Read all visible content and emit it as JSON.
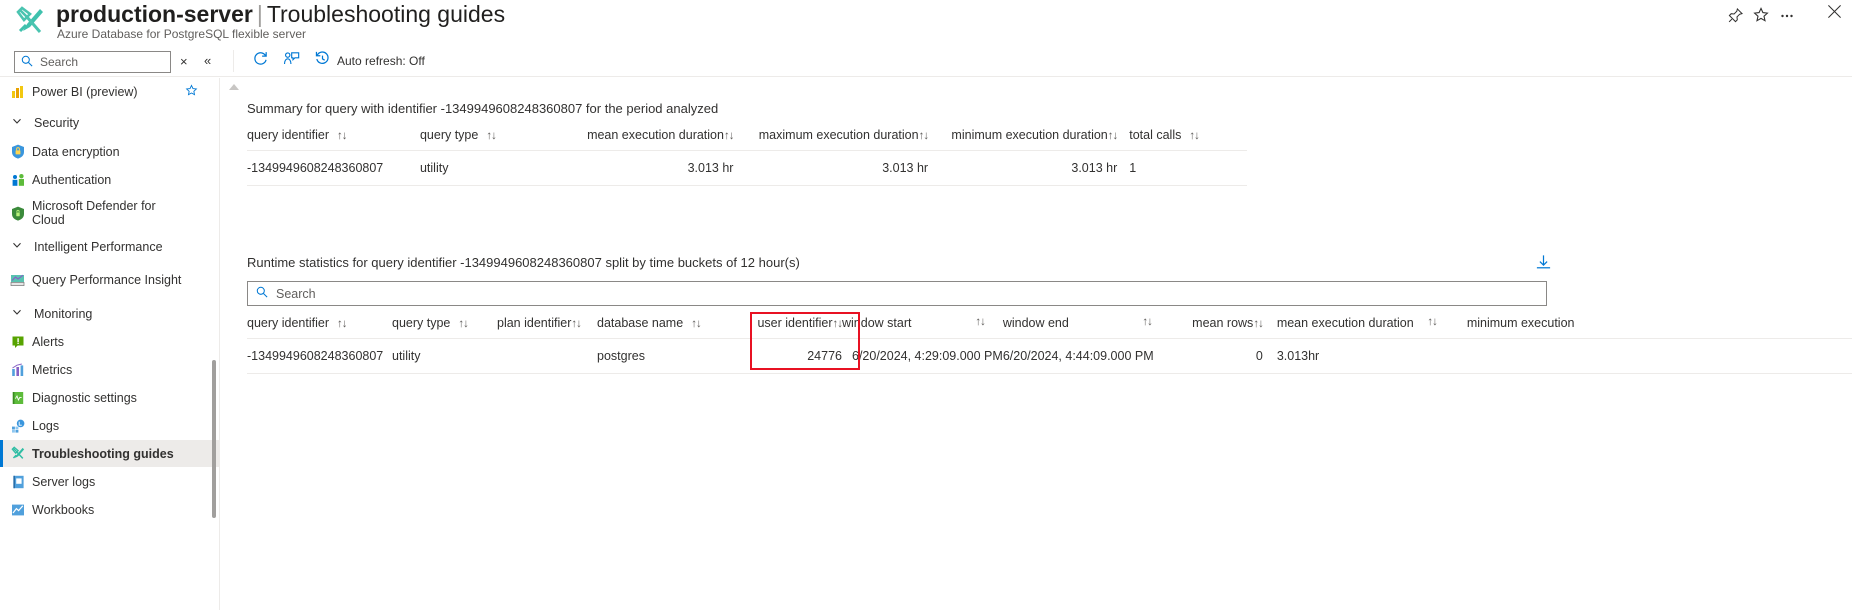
{
  "header": {
    "resource_name": "production-server",
    "separator": "|",
    "blade_name": "Troubleshooting guides",
    "subtitle": "Azure Database for PostgreSQL flexible server",
    "pin_icon": "pin-icon",
    "favorite_icon": "star-icon",
    "more_icon": "ellipsis-icon",
    "close_icon": "close-icon"
  },
  "toolbar": {
    "search_placeholder": "Search",
    "clear_label": "×",
    "collapse_label": "«",
    "refresh_label": "",
    "refresh_icon": "refresh-icon",
    "feedback_icon": "feedback-icon",
    "auto_refresh_icon": "clock-history-icon",
    "auto_refresh_label": "Auto refresh: Off"
  },
  "sidebar": {
    "items": [
      {
        "label": "Power BI (preview)",
        "type": "item",
        "icon": "powerbi-icon",
        "starred": true,
        "selected": false
      },
      {
        "label": "Security",
        "type": "group",
        "icon": "chevron-down-icon",
        "selected": false
      },
      {
        "label": "Data encryption",
        "type": "item",
        "icon": "key-shield-icon",
        "selected": false
      },
      {
        "label": "Authentication",
        "type": "item",
        "icon": "users-icon",
        "selected": false
      },
      {
        "label": "Microsoft Defender for Cloud",
        "type": "item",
        "icon": "defender-shield-icon",
        "selected": false
      },
      {
        "label": "Intelligent Performance",
        "type": "group",
        "icon": "chevron-down-icon",
        "selected": false
      },
      {
        "label": "Query Performance Insight",
        "type": "item",
        "icon": "query-insight-icon",
        "selected": false
      },
      {
        "label": "Monitoring",
        "type": "group",
        "icon": "chevron-down-icon",
        "selected": false
      },
      {
        "label": "Alerts",
        "type": "item",
        "icon": "alert-icon",
        "selected": false
      },
      {
        "label": "Metrics",
        "type": "item",
        "icon": "metrics-icon",
        "selected": false
      },
      {
        "label": "Diagnostic settings",
        "type": "item",
        "icon": "diagnostic-icon",
        "selected": false
      },
      {
        "label": "Logs",
        "type": "item",
        "icon": "logs-icon",
        "selected": false
      },
      {
        "label": "Troubleshooting guides",
        "type": "item",
        "icon": "wrench-icon",
        "selected": true
      },
      {
        "label": "Server logs",
        "type": "item",
        "icon": "server-logs-icon",
        "selected": false
      },
      {
        "label": "Workbooks",
        "type": "item",
        "icon": "workbooks-icon",
        "selected": false
      }
    ]
  },
  "summary_section": {
    "title": "Summary for query with identifier -1349949608248360807 for the period analyzed",
    "columns": [
      {
        "label": "query identifier",
        "sortable": true,
        "align": "left"
      },
      {
        "label": "query type",
        "sortable": true,
        "align": "left"
      },
      {
        "label": "mean execution duration",
        "sortable": true,
        "align": "right"
      },
      {
        "label": "maximum execution duration",
        "sortable": true,
        "align": "right"
      },
      {
        "label": "minimum execution duration",
        "sortable": true,
        "align": "right"
      },
      {
        "label": "total calls",
        "sortable": true,
        "align": "left"
      }
    ],
    "rows": [
      {
        "query_identifier": "-1349949608248360807",
        "query_type": "utility",
        "mean_execution_duration": "3.013 hr",
        "maximum_execution_duration": "3.013 hr",
        "minimum_execution_duration": "3.013 hr",
        "total_calls": "1"
      }
    ]
  },
  "runtime_section": {
    "title": "Runtime statistics for query identifier -1349949608248360807 split by time buckets of 12 hour(s)",
    "download_icon": "download-icon",
    "search_placeholder": "Search",
    "columns": [
      {
        "label": "query identifier",
        "sortable": true,
        "align": "left"
      },
      {
        "label": "query type",
        "sortable": true,
        "align": "left"
      },
      {
        "label": "plan identifier",
        "sortable": true,
        "align": "left"
      },
      {
        "label": "database name",
        "sortable": true,
        "align": "left"
      },
      {
        "label": "user identifier",
        "sortable": true,
        "align": "right",
        "highlighted": true
      },
      {
        "label": "window start",
        "sortable": true,
        "align": "left"
      },
      {
        "label": "window end",
        "sortable": true,
        "align": "left"
      },
      {
        "label": "mean rows",
        "sortable": true,
        "align": "right"
      },
      {
        "label": "mean execution duration",
        "sortable": true,
        "align": "left"
      },
      {
        "label": "minimum execution",
        "sortable": false,
        "align": "left"
      }
    ],
    "rows": [
      {
        "query_identifier": "-1349949608248360807",
        "query_type": "utility",
        "plan_identifier": "",
        "database_name": "postgres",
        "user_identifier": "24776",
        "window_start": "6/20/2024, 4:29:09.000 PM",
        "window_end": "6/20/2024, 4:44:09.000 PM",
        "mean_rows": "0",
        "mean_execution_duration": "3.013hr",
        "minimum_execution": ""
      }
    ]
  },
  "colors": {
    "accent": "#0078d4",
    "highlight": "#e81123",
    "selected_bg": "#edebe9"
  }
}
